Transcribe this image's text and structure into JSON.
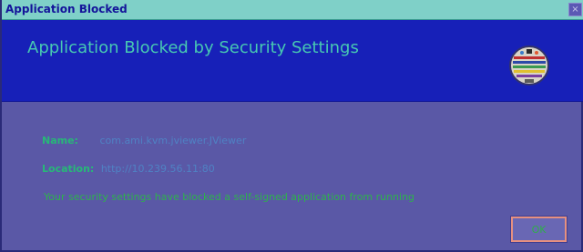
{
  "window": {
    "title": "Application Blocked"
  },
  "header": {
    "title": "Application Blocked by Security Settings"
  },
  "fields": {
    "name_label": "Name:",
    "name_value": "com.ami.kvm.jviewer.JViewer",
    "location_label": "Location:",
    "location_value": "http://10.239.56.11:80"
  },
  "message": "Your security settings have blocked a self-signed application from running",
  "buttons": {
    "ok": "OK",
    "close": "×"
  },
  "icons": {
    "header": "java-emblem-icon",
    "close": "close-icon"
  },
  "colors": {
    "titlebar": "#7fd0c8",
    "header_bg": "#1720b8",
    "body_bg": "#5a58a6",
    "header_text": "#47c8b2",
    "label_text": "#27b878",
    "value_text": "#4f82c4",
    "message_text": "#2eb24c"
  }
}
